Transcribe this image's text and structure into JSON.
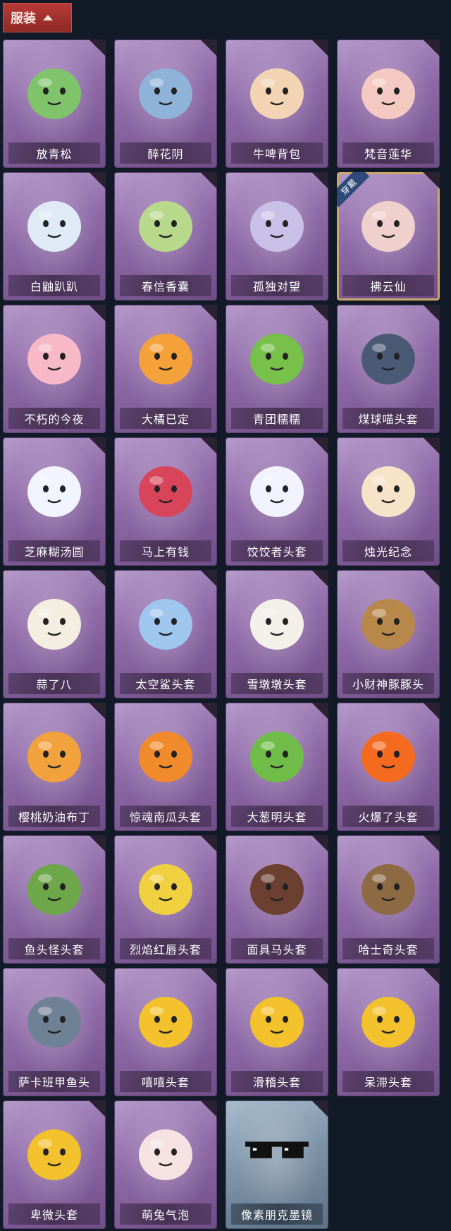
{
  "header": {
    "title": "服装",
    "chevron_icon": "chevron-up-icon"
  },
  "items": [
    {
      "label": "放青松",
      "icon": "bonsai-tree-icon",
      "bg": "purple"
    },
    {
      "label": "醉花阴",
      "icon": "dreamcatcher-icon",
      "bg": "purple"
    },
    {
      "label": "牛啤背包",
      "icon": "cow-barrel-icon",
      "bg": "purple"
    },
    {
      "label": "梵音莲华",
      "icon": "chibi-figure-icon",
      "bg": "purple"
    },
    {
      "label": "白鼬趴趴",
      "icon": "weasel-plush-icon",
      "bg": "purple"
    },
    {
      "label": "春信香囊",
      "icon": "sachet-icon",
      "bg": "purple"
    },
    {
      "label": "孤独对望",
      "icon": "figure-charm-icon",
      "bg": "purple"
    },
    {
      "label": "拂云仙",
      "icon": "cloud-fairy-charm-icon",
      "bg": "purple",
      "equipped": true,
      "badge": "穿戴"
    },
    {
      "label": "不朽的今夜",
      "icon": "pink-fox-icon",
      "bg": "purple"
    },
    {
      "label": "大橘已定",
      "icon": "orange-slice-face-icon",
      "bg": "purple"
    },
    {
      "label": "青团糯糯",
      "icon": "green-rice-ball-icon",
      "bg": "purple"
    },
    {
      "label": "煤球喵头套",
      "icon": "black-cat-head-icon",
      "bg": "purple"
    },
    {
      "label": "芝麻糊汤圆",
      "icon": "dumpling-head-icon",
      "bg": "purple"
    },
    {
      "label": "马上有钱",
      "icon": "red-horse-head-icon",
      "bg": "purple"
    },
    {
      "label": "饺饺者头套",
      "icon": "cloud-dumpling-head-icon",
      "bg": "purple"
    },
    {
      "label": "烛光纪念",
      "icon": "candle-head-icon",
      "bg": "purple"
    },
    {
      "label": "蒜了八",
      "icon": "garlic-head-icon",
      "bg": "purple"
    },
    {
      "label": "太空鲨头套",
      "icon": "shark-head-icon",
      "bg": "purple"
    },
    {
      "label": "雪墩墩头套",
      "icon": "snowman-head-icon",
      "bg": "purple"
    },
    {
      "label": "小财神豚豚头",
      "icon": "capybara-head-icon",
      "bg": "purple"
    },
    {
      "label": "樱桃奶油布丁",
      "icon": "pudding-head-icon",
      "bg": "purple"
    },
    {
      "label": "惊魂南瓜头套",
      "icon": "pumpkin-head-icon",
      "bg": "purple"
    },
    {
      "label": "大葱明头套",
      "icon": "scallion-head-icon",
      "bg": "purple"
    },
    {
      "label": "火爆了头套",
      "icon": "fire-head-icon",
      "bg": "purple"
    },
    {
      "label": "鱼头怪头套",
      "icon": "fish-head-icon",
      "bg": "purple"
    },
    {
      "label": "烈焰红唇头套",
      "icon": "yellow-mouse-head-icon",
      "bg": "purple"
    },
    {
      "label": "面具马头套",
      "icon": "horse-mask-icon",
      "bg": "purple"
    },
    {
      "label": "哈士奇头套",
      "icon": "husky-head-icon",
      "bg": "purple"
    },
    {
      "label": "萨卡班甲鱼头",
      "icon": "fish-fossil-head-icon",
      "bg": "purple"
    },
    {
      "label": "嘻嘻头套",
      "icon": "grin-emoji-head-icon",
      "bg": "purple"
    },
    {
      "label": "滑稽头套",
      "icon": "smirk-emoji-head-icon",
      "bg": "purple"
    },
    {
      "label": "呆滞头套",
      "icon": "stare-emoji-head-icon",
      "bg": "purple"
    },
    {
      "label": "卑微头套",
      "icon": "shy-emoji-head-icon",
      "bg": "purple"
    },
    {
      "label": "萌兔气泡",
      "icon": "bunny-bubble-icon",
      "bg": "purple"
    },
    {
      "label": "像素朋克墨镜",
      "icon": "pixel-sunglasses-icon",
      "bg": "blue"
    }
  ]
}
